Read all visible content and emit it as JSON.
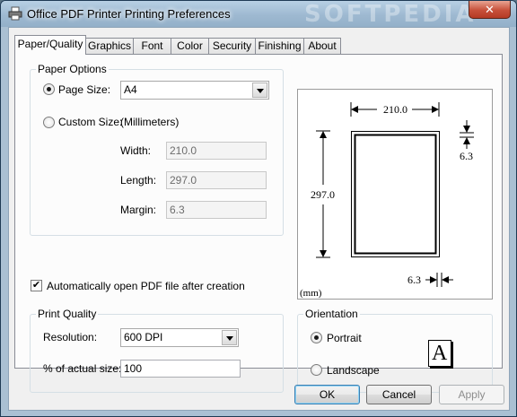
{
  "window": {
    "title": "Office PDF Printer Printing Preferences",
    "watermark": "SOFTPEDIA",
    "close_glyph": "✕",
    "icons": {
      "app": "printer-icon",
      "close": "close-icon"
    }
  },
  "tabs": [
    {
      "label": "Paper/Quality",
      "active": true
    },
    {
      "label": "Graphics"
    },
    {
      "label": "Font"
    },
    {
      "label": "Color"
    },
    {
      "label": "Security"
    },
    {
      "label": "Finishing"
    },
    {
      "label": "About"
    }
  ],
  "paper_options": {
    "group_label": "Paper Options",
    "page_size_label": "Page Size:",
    "page_size_value": "A4",
    "page_size_selected": true,
    "custom_size_label": "Custom Size:",
    "units_label": "(Millimeters)",
    "width_label": "Width:",
    "width_value": "210.0",
    "length_label": "Length:",
    "length_value": "297.0",
    "margin_label": "Margin:",
    "margin_value": "6.3"
  },
  "preview": {
    "width_text": "210.0",
    "height_text": "297.0",
    "margin_top_text": "6.3",
    "margin_right_text": "6.3",
    "units_text": "(mm)"
  },
  "auto_open": {
    "label": "Automatically open PDF file after creation",
    "checked": true,
    "check_glyph": "✔"
  },
  "print_quality": {
    "group_label": "Print Quality",
    "resolution_label": "Resolution:",
    "resolution_value": "600 DPI",
    "actual_size_label": "% of actual size:",
    "actual_size_value": "100"
  },
  "orientation": {
    "group_label": "Orientation",
    "portrait_label": "Portrait",
    "landscape_label": "Landscape",
    "selected": "Portrait",
    "sample_letter": "A"
  },
  "buttons": {
    "ok": "OK",
    "cancel": "Cancel",
    "apply": "Apply"
  }
}
